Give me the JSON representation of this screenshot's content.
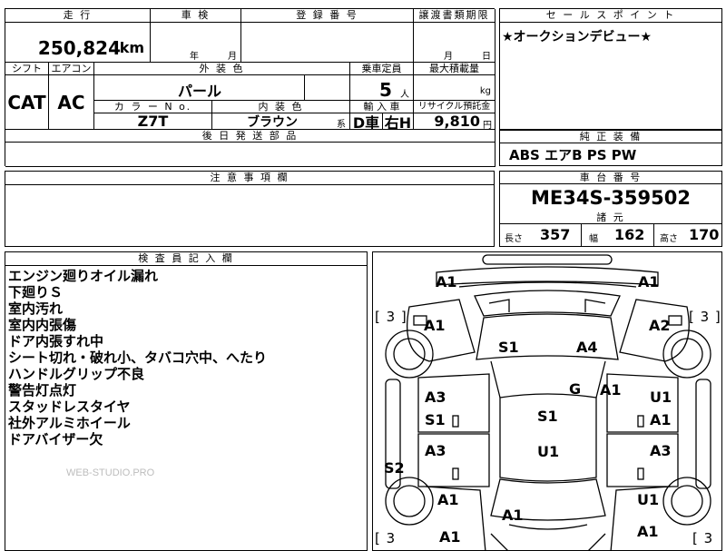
{
  "top": {
    "mileage_header": "走 行",
    "mileage_value": "250,824",
    "mileage_unit": "km",
    "inspection_header": "車 検",
    "inspection_year": "年",
    "inspection_month": "月",
    "registration_header": "登 録 番 号",
    "transfer_header": "譲渡書類期限",
    "transfer_month": "月",
    "transfer_day": "日",
    "shift_header": "シフト",
    "ac_header": "エアコン",
    "shift_value": "CAT",
    "ac_value": "AC",
    "exterior_color_header": "外 装 色",
    "exterior_color_value": "パール",
    "capacity_header": "乗車定員",
    "capacity_value": "5",
    "capacity_unit": "人",
    "max_load_header": "最大積載量",
    "max_load_unit": "kg",
    "color_no_header": "カ ラ ー N o.",
    "color_no_value": "Z7T",
    "interior_color_header": "内 装 色",
    "interior_color_value": "ブラウン",
    "interior_color_suffix": "系",
    "import_header": "輸 入 車",
    "import_value1": "D車",
    "import_value2": "右H",
    "recycle_header": "リサイクル預託金",
    "recycle_value": "9,810",
    "recycle_unit": "円",
    "later_parts_header": "後 日 発 送 部 品"
  },
  "sales_point": {
    "header": "セ ー ル ス ポ イ ン ト",
    "text": "★オークションデビュー★"
  },
  "equipment": {
    "header": "純 正 装 備",
    "text": "ABS エアB PS PW"
  },
  "notes": {
    "header": "注 意 事 項 欄"
  },
  "chassis": {
    "header": "車 台 番 号",
    "value": "ME34S-359502"
  },
  "specs": {
    "header": "諸 元",
    "length_label": "長さ",
    "length_value": "357",
    "width_label": "幅",
    "width_value": "162",
    "height_label": "高さ",
    "height_value": "170"
  },
  "inspector": {
    "header": "検 査 員 記 入 欄",
    "lines": [
      "エンジン廻りオイル漏れ",
      "下廻りＳ",
      "室内汚れ",
      "室内内張傷",
      "ドア内張すれ中",
      "シート切れ・破れ小、タバコ穴中、へたり",
      "ハンドルグリップ不良",
      "警告灯点灯",
      "スタッドレスタイヤ",
      "社外アルミホイール",
      "ドアバイザー欠"
    ],
    "watermark": "WEB-STUDIO.PRO"
  },
  "diagram": {
    "bracket_left_top": "[ 3 ]",
    "bracket_right_top": "[ 3 ]",
    "bracket_left_bottom": "[ 3",
    "bracket_right_bottom": "[ 3",
    "labels": {
      "front_left": "A1",
      "front_right": "A1",
      "fender_left": "A1",
      "fender_right": "A2",
      "seat_front_left": "S1",
      "seat_front_right": "A4",
      "glass": "G",
      "glass_side": "A1",
      "door_fl_a": "A3",
      "door_fl_s": "S1",
      "door_fr_u": "U1",
      "door_fr_a": "A1",
      "roof_s": "S1",
      "door_rl": "A3",
      "roof_u": "U1",
      "door_rr": "A3",
      "sill_left": "S2",
      "rear_fender_left": "A1",
      "rear_fender_right": "U1",
      "rear_a": "A1",
      "rear_bottom_left": "A1",
      "rear_bottom_right": "A1"
    }
  }
}
